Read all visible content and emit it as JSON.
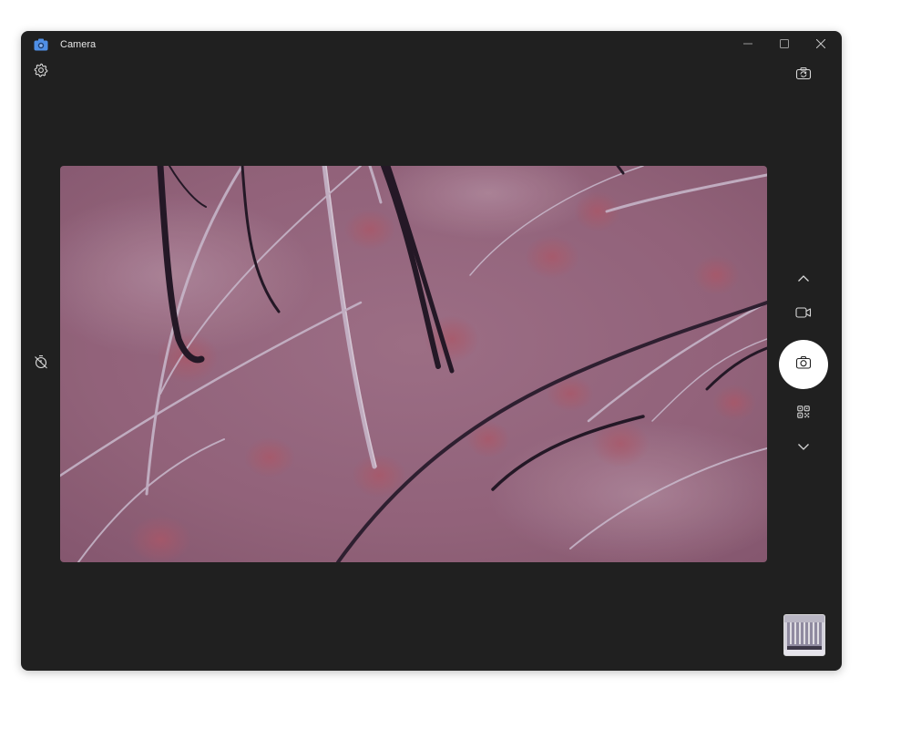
{
  "window": {
    "title": "Camera",
    "app_icon": "camera-app-icon"
  },
  "titlebar": {
    "minimize_icon": "minimize-icon",
    "maximize_icon": "maximize-icon",
    "close_icon": "close-icon"
  },
  "controls": {
    "settings_icon": "gear-icon",
    "switch_camera_icon": "switch-camera-icon",
    "timer_icon": "timer-off-icon",
    "mode_up_icon": "chevron-up-icon",
    "video_mode_icon": "video-camera-icon",
    "photo_shutter_icon": "camera-icon",
    "qr_mode_icon": "qr-code-icon",
    "mode_down_icon": "chevron-down-icon"
  },
  "preview": {
    "content": "live-camera-preview-skin-macro"
  },
  "thumbnail": {
    "content": "last-capture-thumbnail"
  },
  "colors": {
    "window_bg": "#202020",
    "title_text": "#e6e6e6",
    "icon": "#d9d9d9",
    "shutter_bg": "#ffffff",
    "accent": "#4f8fe6"
  }
}
